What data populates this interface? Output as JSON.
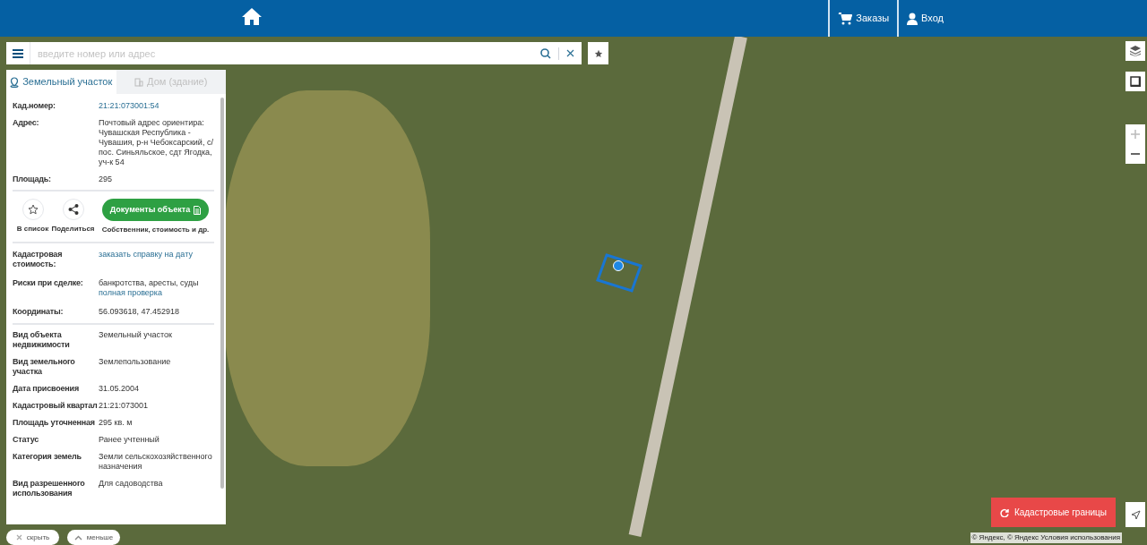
{
  "header": {
    "nav": [
      {
        "kind": "cart",
        "label": "Заказы"
      },
      {
        "kind": "user",
        "label": "Вход"
      }
    ]
  },
  "search": {
    "placeholder": "введите номер или адрес"
  },
  "panel": {
    "tabs": [
      {
        "label": "Земельный участок",
        "selected": true,
        "kind": "land"
      },
      {
        "label": "Дом (здание)",
        "selected": false,
        "kind": "house"
      }
    ],
    "summary": [
      {
        "label": "Кад.номер:",
        "value": "21:21:073001:54",
        "kind": "link"
      },
      {
        "label": "Адрес:",
        "value": "Почтовый адрес ориентира: Чувашская Республика - Чувашия, р-н Чебоксарский, с/пос. Синьяльское, сдт Ягодка, уч-к 54",
        "kind": "text"
      },
      {
        "label": "Площадь:",
        "value": "295",
        "kind": "text"
      }
    ],
    "actions": [
      {
        "kind": "star",
        "label": "В список"
      },
      {
        "kind": "share",
        "label": "Поделиться"
      }
    ],
    "docs_button": "Документы объекта",
    "docs_caption": "Собственник, стоимость и др.",
    "checks": [
      {
        "label": "Кадастровая стоимость:",
        "value": "заказать справку на дату",
        "kind": "link"
      },
      {
        "label": "Риски при сделке:",
        "value": "банкротства, аресты, суды",
        "link": "полная проверка",
        "kind": "text"
      },
      {
        "label": "Координаты:",
        "value": "56.093618, 47.452918",
        "kind": "text"
      }
    ],
    "details": [
      {
        "label": "Вид объекта недвижимости",
        "value": "Земельный участок"
      },
      {
        "label": "Вид земельного участка",
        "value": "Землепользование"
      },
      {
        "label": "Дата присвоения",
        "value": "31.05.2004"
      },
      {
        "label": "Кадастровый квартал",
        "value": "21:21:073001"
      },
      {
        "label": "Площадь уточненная",
        "value": "295 кв. м"
      },
      {
        "label": "Статус",
        "value": "Ранее учтенный"
      },
      {
        "label": "Категория земель",
        "value": "Земли сельскохозяйственного назначения"
      },
      {
        "label": "Вид разрешенного использования",
        "value": "Для садоводства"
      }
    ]
  },
  "bottom_buttons": [
    {
      "kind": "close",
      "label": "скрыть"
    },
    {
      "kind": "up",
      "label": "меньше"
    }
  ],
  "map": {
    "layer_button": "Кадастровые границы",
    "attribution": "© Яндекс, © Яндекс Условия использования"
  }
}
